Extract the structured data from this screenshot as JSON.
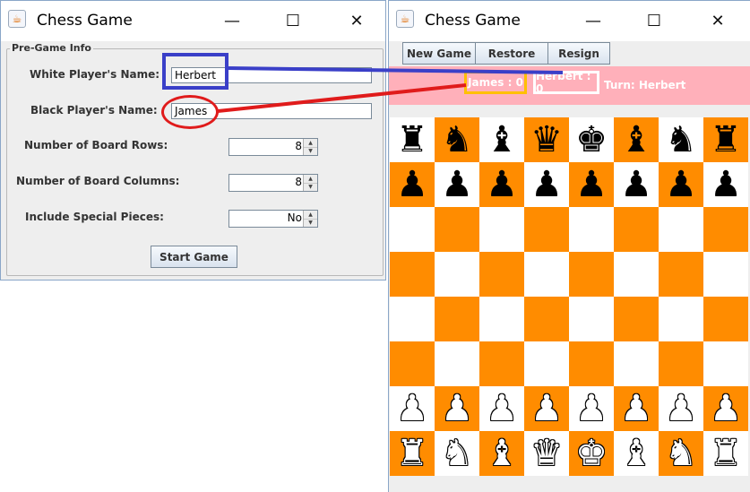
{
  "colors": {
    "board_dark": "#ff8c00",
    "board_light": "#ffffff",
    "status_bar": "#ffb0ba",
    "black_score_border": "#ffc000",
    "white_score_border": "#ffffff",
    "annotation_blue": "#3a3fc8",
    "annotation_red": "#e01b1b"
  },
  "left_window": {
    "title": "Chess Game",
    "app_icon": "java-cup-icon",
    "controls": {
      "minimize": "—",
      "maximize": "☐",
      "close": "✕"
    },
    "group_title": "Pre-Game Info",
    "fields": {
      "white_label": "White Player's Name:",
      "white_value": "Herbert",
      "black_label": "Black Player's Name:",
      "black_value": "James",
      "rows_label": "Number of Board Rows:",
      "rows_value": "8",
      "cols_label": "Number of Board Columns:",
      "cols_value": "8",
      "special_label": "Include Special Pieces:",
      "special_value": "No"
    },
    "start_button": "Start Game"
  },
  "right_window": {
    "title": "Chess Game",
    "app_icon": "java-cup-icon",
    "controls": {
      "minimize": "—",
      "maximize": "☐",
      "close": "✕"
    },
    "toolbar": {
      "new_game": "New Game",
      "restore": "Restore",
      "resign": "Resign"
    },
    "scores": {
      "black": "James : 0",
      "white": "Herbert : 0"
    },
    "turn": "Turn: Herbert"
  },
  "board": {
    "rows": [
      [
        "♜",
        "♞",
        "♝",
        "♛",
        "♚",
        "♝",
        "♞",
        "♜"
      ],
      [
        "♟",
        "♟",
        "♟",
        "♟",
        "♟",
        "♟",
        "♟",
        "♟"
      ],
      [
        "",
        "",
        "",
        "",
        "",
        "",
        "",
        ""
      ],
      [
        "",
        "",
        "",
        "",
        "",
        "",
        "",
        ""
      ],
      [
        "",
        "",
        "",
        "",
        "",
        "",
        "",
        ""
      ],
      [
        "",
        "",
        "",
        "",
        "",
        "",
        "",
        ""
      ],
      [
        "♟",
        "♟",
        "♟",
        "♟",
        "♟",
        "♟",
        "♟",
        "♟"
      ],
      [
        "♜",
        "♞",
        "♝",
        "♛",
        "♚",
        "♝",
        "♞",
        "♜"
      ]
    ],
    "row_colors": [
      "black",
      "black",
      "",
      "",
      "",
      "",
      "white",
      "white"
    ],
    "top_left_light": true
  },
  "arrow_glyphs": {
    "up": "▲",
    "down": "▼"
  }
}
